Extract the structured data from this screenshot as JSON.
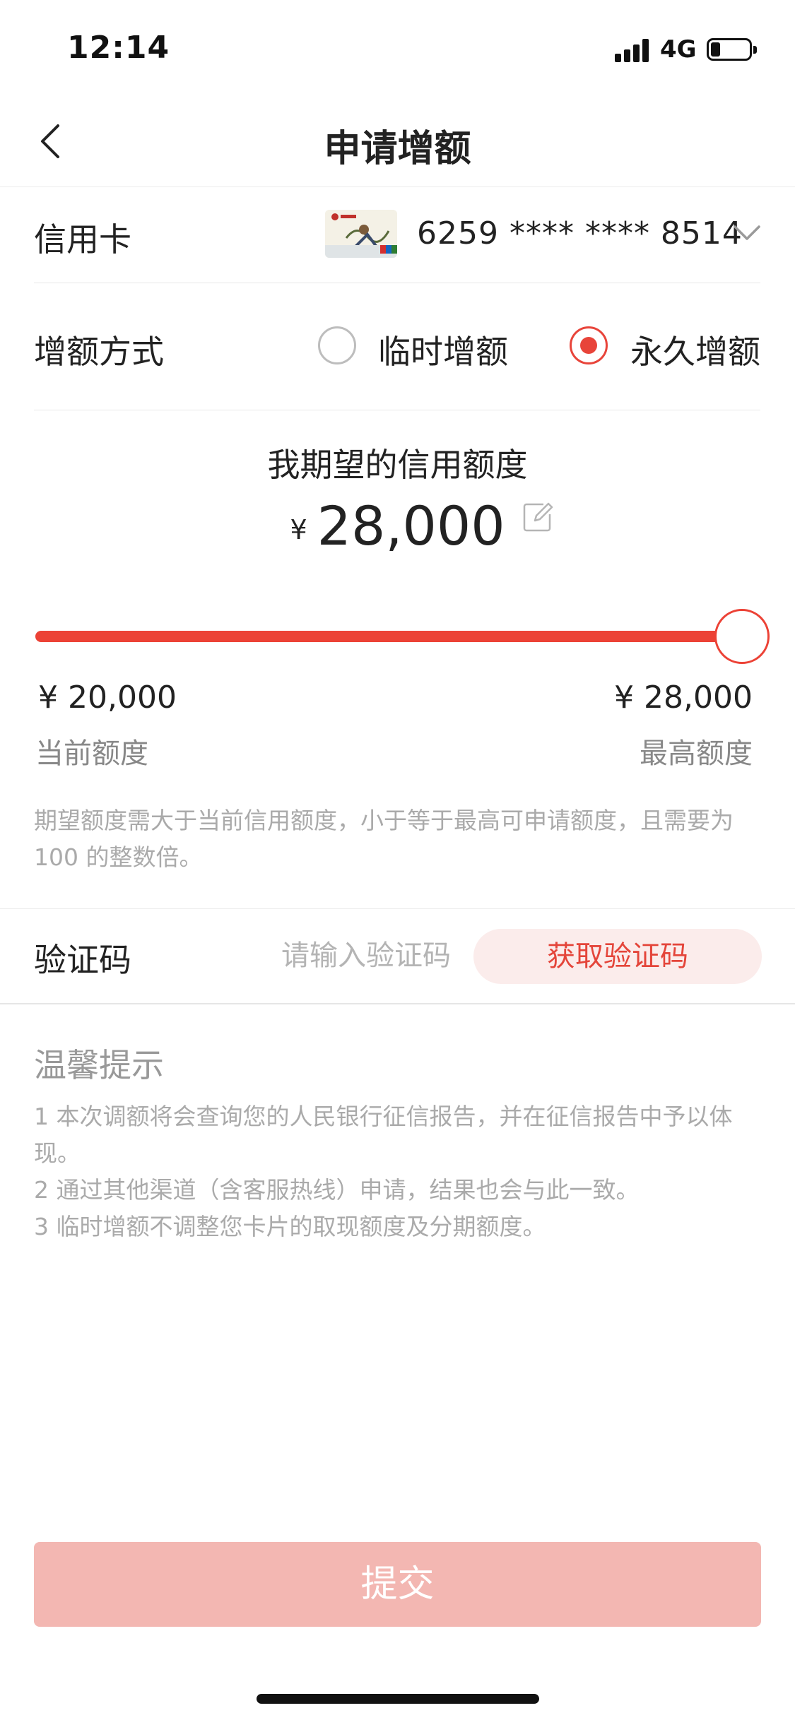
{
  "status_bar": {
    "time": "12:14",
    "network": "4G",
    "battery_level": 0.2
  },
  "header": {
    "title": "申请增额",
    "back_icon": "chevron-left-icon"
  },
  "card_row": {
    "label": "信用卡",
    "card_number": "6259 **** **** 8514",
    "dropdown_icon": "chevron-down-icon"
  },
  "mode_row": {
    "label": "增额方式",
    "options": [
      {
        "label": "临时增额",
        "selected": false
      },
      {
        "label": "永久增额",
        "selected": true
      }
    ]
  },
  "expected": {
    "title": "我期望的信用额度",
    "currency": "¥",
    "amount": "28,000",
    "edit_icon": "edit-icon"
  },
  "slider": {
    "fraction": 1.0,
    "min_value": "¥  20,000",
    "max_value": "¥  28,000",
    "min_label": "当前额度",
    "max_label": "最高额度",
    "accent_color": "#ec4236"
  },
  "hint": "期望额度需大于当前信用额度，小于等于最高可申请额度，且需要为100 的整数倍。",
  "verify_row": {
    "label": "验证码",
    "placeholder": "请输入验证码",
    "value": "",
    "get_code_label": "获取验证码"
  },
  "tips": {
    "title": "温馨提示",
    "items": [
      "1  本次调额将会查询您的人民银行征信报告，并在征信报告中予以体现。",
      "2  通过其他渠道（含客服热线）申请，结果也会与此一致。",
      "3  临时增额不调整您卡片的取现额度及分期额度。"
    ]
  },
  "submit": {
    "label": "提交",
    "color": "#f3b7b2"
  }
}
